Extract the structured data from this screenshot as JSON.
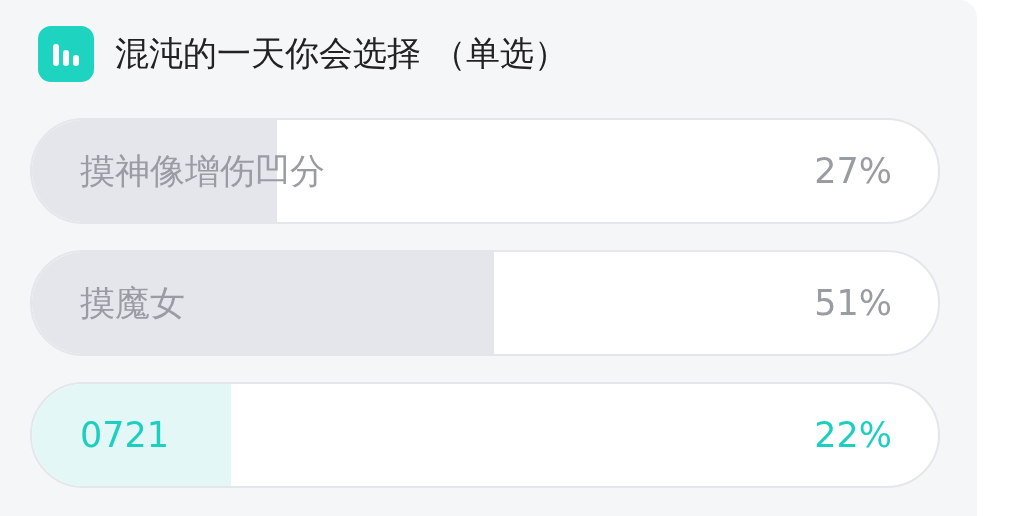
{
  "poll": {
    "title": "混沌的一天你会选择 （单选）",
    "options": [
      {
        "label": "摸神像增伤凹分",
        "percent": "27%",
        "level": 0.27,
        "selected": false
      },
      {
        "label": "摸魔女",
        "percent": "51%",
        "level": 0.51,
        "selected": false
      },
      {
        "label": "0721",
        "percent": "22%",
        "level": 0.22,
        "selected": true
      }
    ]
  }
}
